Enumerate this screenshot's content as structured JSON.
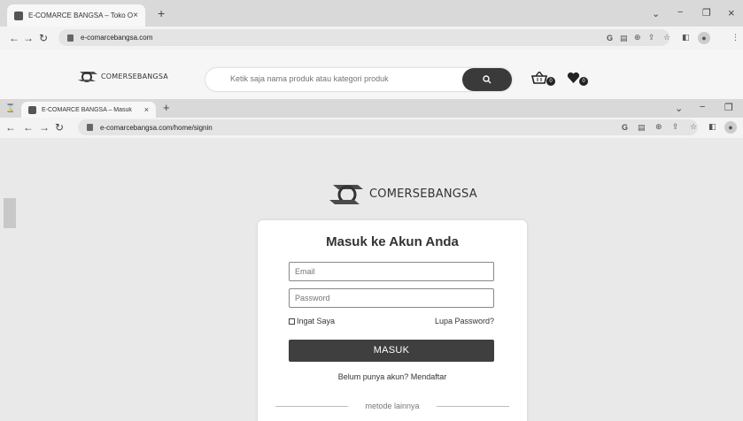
{
  "back_window": {
    "tab": {
      "title": "E-COMARCE BANGSA – Toko Or",
      "close": "×"
    },
    "new_tab": "+",
    "window_controls": {
      "minimize": "−",
      "restore": "❐",
      "close": "×",
      "menu_chevron": "⌄"
    },
    "url": "e-comarcebangsa.com"
  },
  "site": {
    "logo_text": "COMERSEBANGSA",
    "search_placeholder": "Ketik saja nama produk atau kategori produk",
    "cart_count": "0",
    "wishlist_count": "0"
  },
  "front_window": {
    "tab": {
      "title": "E-COMARCE BANGSA – Masuk",
      "close": "×"
    },
    "new_tab": "+",
    "window_controls": {
      "minimize": "−",
      "restore": "❐",
      "menu_chevron": "⌄"
    },
    "url": "e-comarcebangsa.com/home/signin"
  },
  "login": {
    "logo_text": "COMERSEBANGSA",
    "title": "Masuk ke Akun Anda",
    "email_placeholder": "Email",
    "password_placeholder": "Password",
    "remember_label": "Ingat Saya",
    "forgot_label": "Lupa Password?",
    "submit_label": "MASUK",
    "signup_text": "Belum punya akun? Mendaftar",
    "divider_text": "metode lainnya"
  },
  "toolbar_icons": [
    "google-icon",
    "translate-icon",
    "zoom-icon",
    "share-icon",
    "bookmark-star-icon",
    "sidepanel-icon",
    "profile-icon",
    "menu-icon"
  ]
}
